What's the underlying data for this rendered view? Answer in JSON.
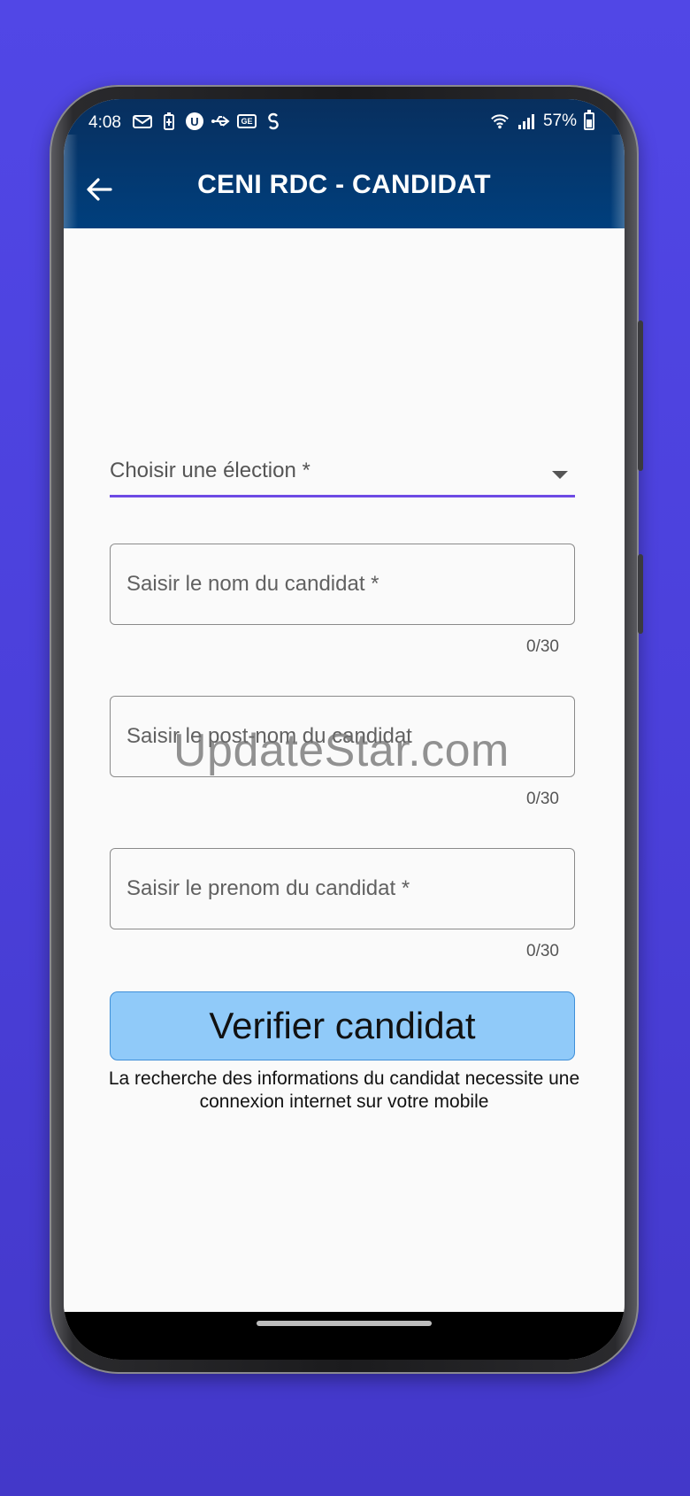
{
  "status_bar": {
    "time": "4:08",
    "left_icons": [
      "mail-icon",
      "battery-saver-icon",
      "ublock-icon",
      "usb-icon",
      "ge-icon",
      "shazam-icon"
    ],
    "ge_text": "GE",
    "u_text": "U",
    "battery_percent": "57%",
    "right_icons": [
      "wifi-icon",
      "signal-icon",
      "battery-icon"
    ]
  },
  "app_bar": {
    "title": "CENI RDC - CANDIDAT",
    "back_icon": "arrow-left-icon",
    "background": "#003f7d"
  },
  "form": {
    "election_dropdown": {
      "label": "Choisir une élection *",
      "accent": "#6d4ae4"
    },
    "nom": {
      "placeholder": "Saisir le nom du candidat *",
      "counter": "0/30"
    },
    "post_nom": {
      "placeholder": "Saisir le post-nom du candidat",
      "counter": "0/30"
    },
    "prenom": {
      "placeholder": "Saisir le prenom du candidat *",
      "counter": "0/30"
    },
    "verify_button": {
      "label": "Verifier candidat",
      "color": "#90caf9"
    },
    "note_line1": "La recherche des informations du candidat necessite une",
    "note_line2": "connexion internet sur votre mobile"
  },
  "watermark": "UpdateStar.com",
  "background_color": "#4f46e5"
}
